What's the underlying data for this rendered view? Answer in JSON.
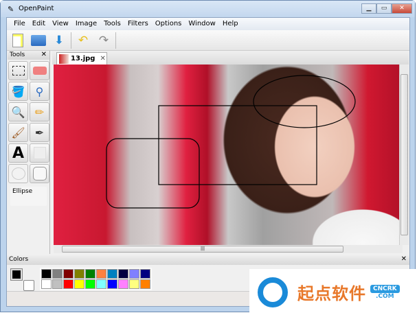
{
  "window": {
    "title": "OpenPaint"
  },
  "menu": [
    "File",
    "Edit",
    "View",
    "Image",
    "Tools",
    "Filters",
    "Options",
    "Window",
    "Help"
  ],
  "toolbar": {
    "icons": [
      "new-icon",
      "open-icon",
      "save-icon",
      "undo-icon",
      "redo-icon"
    ]
  },
  "tools_panel": {
    "title": "Tools",
    "close": "✕",
    "selected_tool_name": "Ellipse",
    "tools": [
      "rectangle-select",
      "eraser",
      "fill-bucket",
      "color-picker",
      "zoom",
      "pencil",
      "brush",
      "clone-stamp",
      "text",
      "rectangle",
      "ellipse",
      "rounded-rectangle"
    ]
  },
  "document": {
    "tab_label": "13.jpg",
    "tab_close": "✕",
    "scroll_grip": "|||"
  },
  "colors_panel": {
    "title": "Colors",
    "close": "✕",
    "primary": "#000000",
    "secondary": "#ffffff",
    "palette": [
      "#000000",
      "#808080",
      "#800000",
      "#808000",
      "#008000",
      "#ff8040",
      "#0080c0",
      "#000040",
      "#8080ff",
      "#000080",
      "#ffffff",
      "#c0c0c0",
      "#ff0000",
      "#ffff00",
      "#00ff00",
      "#80ffff",
      "#0000ff",
      "#ff80ff",
      "#ffff80",
      "#ff8000"
    ]
  },
  "watermark": {
    "text_cn": "起点软件",
    "badge": "CNCRK",
    "domain": ".COM"
  }
}
